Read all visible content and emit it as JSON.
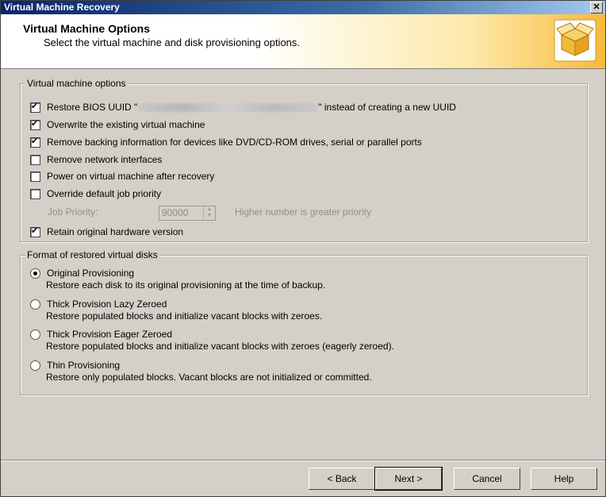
{
  "window": {
    "title": "Virtual Machine Recovery",
    "close_glyph": "✕"
  },
  "header": {
    "title": "Virtual Machine Options",
    "subtitle": "Select the virtual machine and disk provisioning options."
  },
  "vm_options": {
    "legend": "Virtual machine options",
    "restore_uuid": {
      "prefix": "Restore BIOS UUID \"",
      "suffix": "\" instead of creating a new UUID",
      "checked": true
    },
    "overwrite": {
      "label": "Overwrite the existing virtual machine",
      "checked": true
    },
    "remove_backing": {
      "label": "Remove backing information for devices like DVD/CD-ROM drives, serial or parallel ports",
      "checked": true
    },
    "remove_network": {
      "label": "Remove network interfaces",
      "checked": false
    },
    "power_on": {
      "label": "Power on virtual machine after recovery",
      "checked": false
    },
    "override_priority": {
      "label": "Override default job priority",
      "checked": false
    },
    "job_priority": {
      "label": "Job Priority:",
      "value": "90000",
      "hint": "Higher number is greater priority"
    },
    "retain_hw": {
      "label": "Retain original hardware version",
      "checked": true
    }
  },
  "disk_format": {
    "legend": "Format of restored virtual disks",
    "options": [
      {
        "label": "Original Provisioning",
        "desc": "Restore each disk to its original provisioning at the time of backup.",
        "selected": true
      },
      {
        "label": "Thick Provision Lazy Zeroed",
        "desc": "Restore populated blocks and initialize vacant blocks with zeroes.",
        "selected": false
      },
      {
        "label": "Thick Provision Eager Zeroed",
        "desc": "Restore populated blocks and initialize vacant blocks with zeroes (eagerly zeroed).",
        "selected": false
      },
      {
        "label": "Thin Provisioning",
        "desc": "Restore only populated blocks. Vacant blocks are not initialized or committed.",
        "selected": false
      }
    ]
  },
  "buttons": {
    "back": "< Back",
    "next": "Next >",
    "cancel": "Cancel",
    "help": "Help"
  }
}
